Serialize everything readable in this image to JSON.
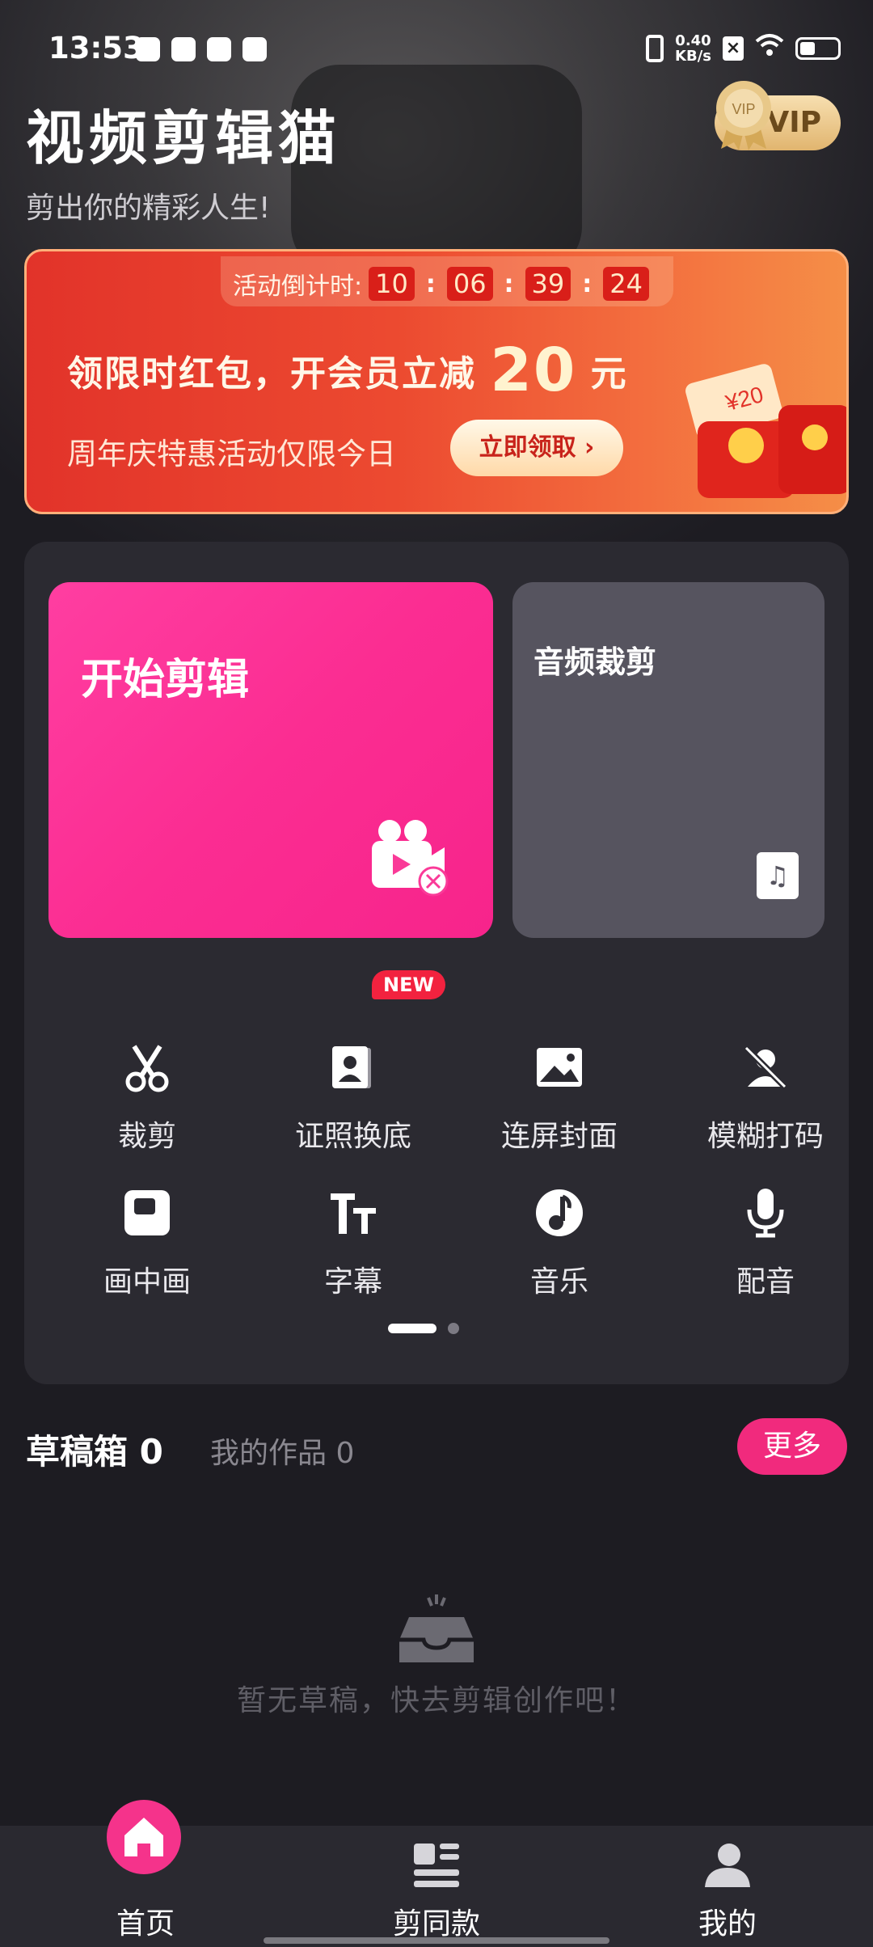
{
  "status_bar": {
    "time": "13:53",
    "net_speed_value": "0.40",
    "net_speed_unit": "KB/s"
  },
  "header": {
    "title": "视频剪辑猫",
    "slogan": "剪出你的精彩人生!",
    "vip_label": "VIP",
    "vip_badge_text": "VIP"
  },
  "promo": {
    "countdown_label": "活动倒计时:",
    "countdown": [
      "10",
      "06",
      "39",
      "24"
    ],
    "headline_pre": "领限时红包，开会员立减",
    "headline_amount": "20",
    "headline_unit": "元",
    "subline": "周年庆特惠活动仅限今日",
    "cta": "立即领取",
    "cta_arrow": "›",
    "coupon_text": "¥20"
  },
  "main": {
    "start_edit_label": "开始剪辑",
    "audio_trim_label": "音频裁剪",
    "new_badge": "NEW",
    "tools": [
      {
        "label": "裁剪",
        "icon": "scissors-icon"
      },
      {
        "label": "证照换底",
        "icon": "id-photo-icon"
      },
      {
        "label": "连屏封面",
        "icon": "image-icon"
      },
      {
        "label": "模糊打码",
        "icon": "blur-mask-icon"
      },
      {
        "label": "画中画",
        "icon": "picture-in-picture-icon"
      },
      {
        "label": "字幕",
        "icon": "subtitle-icon"
      },
      {
        "label": "音乐",
        "icon": "music-note-icon"
      },
      {
        "label": "配音",
        "icon": "microphone-icon"
      }
    ]
  },
  "drafts": {
    "draft_tab": "草稿箱 0",
    "works_tab": "我的作品 0",
    "more_button": "更多",
    "empty_text": "暂无草稿，快去剪辑创作吧！"
  },
  "bottom_nav": [
    {
      "label": "首页",
      "icon": "home-icon"
    },
    {
      "label": "剪同款",
      "icon": "template-icon"
    },
    {
      "label": "我的",
      "icon": "profile-icon"
    }
  ],
  "colors": {
    "accent": "#f5338b",
    "promo": "#e2332a",
    "card": "#2b2a31",
    "background": "#1d1c22"
  }
}
